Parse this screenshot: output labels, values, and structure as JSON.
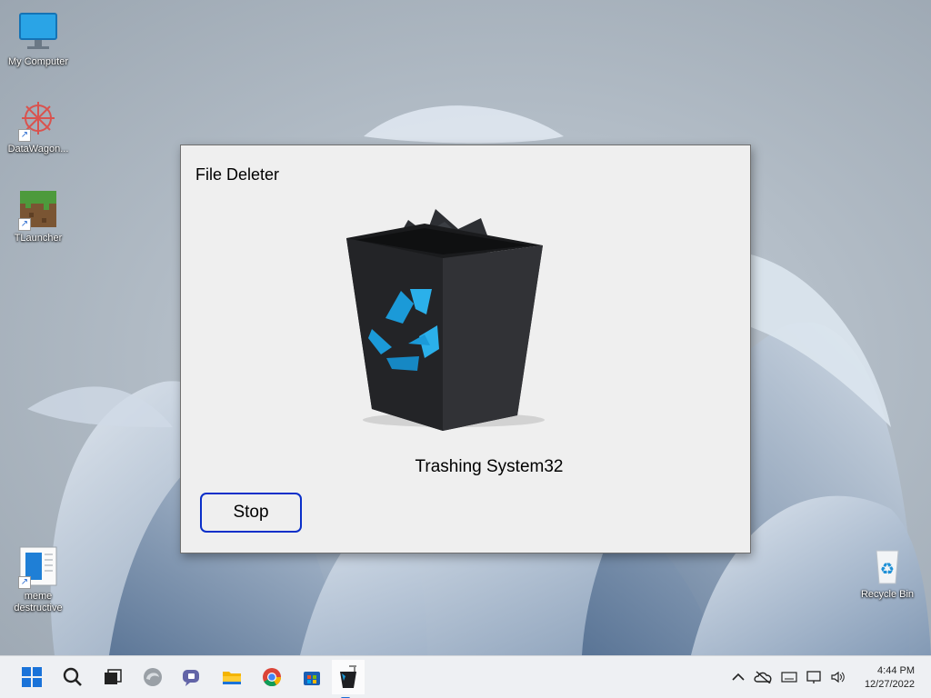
{
  "desktop": {
    "icons": [
      {
        "label": "My Computer",
        "icon": "monitor-icon"
      },
      {
        "label": "DataWagon...",
        "icon": "starburst-app-icon"
      },
      {
        "label": "TLauncher",
        "icon": "grass-block-icon"
      },
      {
        "label": "meme destructive",
        "icon": "document-icon"
      },
      {
        "label": "Recycle Bin",
        "icon": "recycle-bin-icon"
      }
    ]
  },
  "dialog": {
    "title": "File Deleter",
    "status": "Trashing System32",
    "stop_label": "Stop",
    "image": "full-recycle-bin-icon",
    "button_border_color": "#0a2fc9"
  },
  "taskbar": {
    "apps": [
      "windows-start-icon",
      "search-icon",
      "task-view-icon",
      "edge-icon",
      "chat-icon",
      "file-explorer-icon",
      "chrome-icon",
      "store-icon",
      "file-deleter-icon"
    ],
    "tray": [
      "chevron-up-icon",
      "onedrive-icon",
      "keyboard-icon",
      "network-icon",
      "volume-icon"
    ],
    "time": "4:44 PM",
    "date": "12/27/2022"
  }
}
